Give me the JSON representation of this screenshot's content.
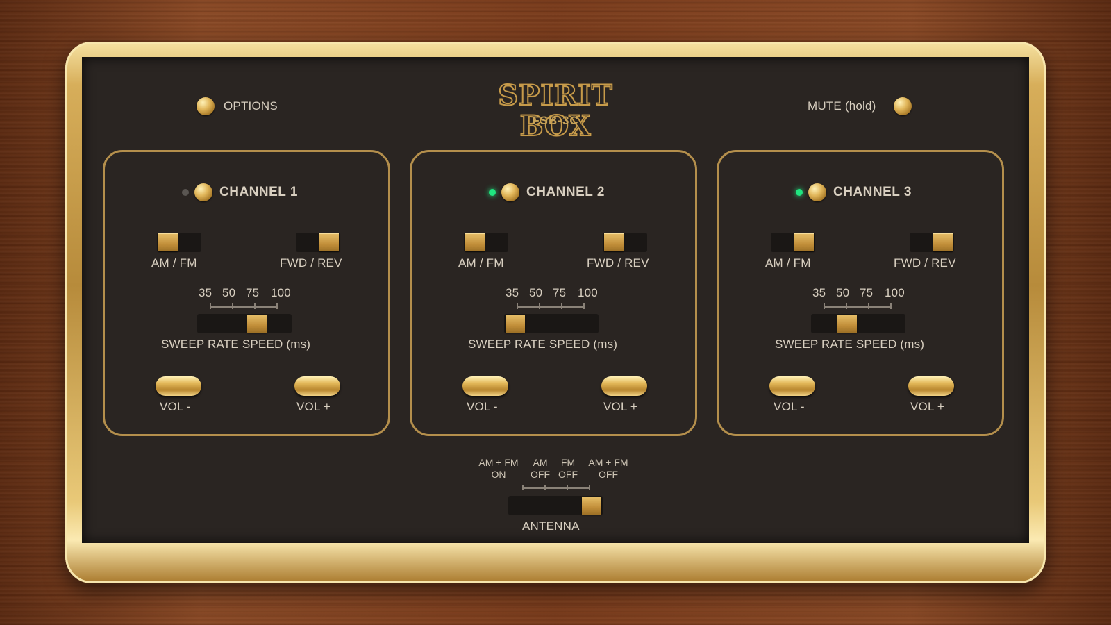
{
  "logo": {
    "name": "SPIRIT BOX",
    "model": "FSB-3C"
  },
  "options_label": "OPTIONS",
  "mute_label": "MUTE (hold)",
  "channels": [
    {
      "name": "CHANNEL 1",
      "active": false,
      "band_label": "AM / FM",
      "band": "AM",
      "direction_label": "FWD / REV",
      "direction": "REV",
      "sweep_ticks": [
        "35",
        "50",
        "75",
        "100"
      ],
      "sweep_value": "75",
      "sweep_label": "SWEEP RATE SPEED (ms)",
      "vol_minus": "VOL -",
      "vol_plus": "VOL +"
    },
    {
      "name": "CHANNEL 2",
      "active": true,
      "band_label": "AM / FM",
      "band": "AM",
      "direction_label": "FWD / REV",
      "direction": "FWD",
      "sweep_ticks": [
        "35",
        "50",
        "75",
        "100"
      ],
      "sweep_value": "35",
      "sweep_label": "SWEEP RATE SPEED (ms)",
      "vol_minus": "VOL -",
      "vol_plus": "VOL +"
    },
    {
      "name": "CHANNEL 3",
      "active": true,
      "band_label": "AM / FM",
      "band": "FM",
      "direction_label": "FWD / REV",
      "direction": "REV",
      "sweep_ticks": [
        "35",
        "50",
        "75",
        "100"
      ],
      "sweep_value": "50",
      "sweep_label": "SWEEP RATE SPEED (ms)",
      "vol_minus": "VOL -",
      "vol_plus": "VOL +"
    }
  ],
  "antenna": {
    "options": [
      {
        "line1": "AM + FM",
        "line2": "ON"
      },
      {
        "line1": "AM",
        "line2": "OFF"
      },
      {
        "line1": "FM",
        "line2": "OFF"
      },
      {
        "line1": "AM + FM",
        "line2": "OFF"
      }
    ],
    "selected": "AM + FM OFF",
    "label": "ANTENNA"
  },
  "colors": {
    "gold": "#c9a45a",
    "panel": "#2a2522",
    "led_on": "#20e680"
  }
}
